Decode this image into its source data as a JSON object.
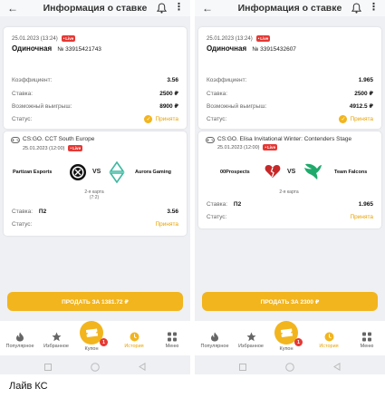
{
  "screens": [
    {
      "header": {
        "title": "Информация о ставке"
      },
      "bet": {
        "datetime": "25.01.2023 (13:24)",
        "live": "Live",
        "type": "Одиночная",
        "number": "№ 33915421743",
        "coef_label": "Коэффициент:",
        "coef_value": "3.56",
        "stake_label": "Ставка:",
        "stake_value": "2500 ₽",
        "win_label": "Возможный выигрыш:",
        "win_value": "8900 ₽",
        "status_label": "Статус:",
        "status_value": "Принята"
      },
      "event": {
        "league": "CS:GO. CCT South Europe",
        "datetime": "25.01.2023 (12:00)",
        "live": "Live",
        "team1": "Partizan Esports",
        "vs": "VS",
        "team2": "Aurora Gaming",
        "map": "2-я карта",
        "score": "(7:2)",
        "stake_label": "Ставка:",
        "stake_value": "П2",
        "coef": "3.56",
        "status_label": "Статус:",
        "status_value": "Принята"
      },
      "sell_button": "ПРОДАТЬ ЗА 1381.72 ₽"
    },
    {
      "header": {
        "title": "Информация о ставке"
      },
      "bet": {
        "datetime": "25.01.2023 (13:24)",
        "live": "Live",
        "type": "Одиночная",
        "number": "№ 33915432607",
        "coef_label": "Коэффициент:",
        "coef_value": "1.965",
        "stake_label": "Ставка:",
        "stake_value": "2500 ₽",
        "win_label": "Возможный выигрыш:",
        "win_value": "4912.5 ₽",
        "status_label": "Статус:",
        "status_value": "Принята"
      },
      "event": {
        "league": "CS:GO. Elisa Invitational Winter: Contenders Stage",
        "datetime": "25.01.2023 (12:00)",
        "live": "Live",
        "team1": "00Prospects",
        "vs": "VS",
        "team2": "Team Falcons",
        "map": "2-я карта",
        "stake_label": "Ставка:",
        "stake_value": "П2",
        "coef": "1.965",
        "status_label": "Статус:",
        "status_value": "Принята"
      },
      "sell_button": "ПРОДАТЬ ЗА 2300 ₽"
    }
  ],
  "nav": {
    "popular": "Популярное",
    "favorites": "Избранное",
    "coupon": "Купон",
    "coupon_count": "1",
    "history": "История",
    "menu": "Меню"
  },
  "caption": "Лайв КС",
  "colors": {
    "accent": "#f2b51e",
    "live": "#e53935",
    "background": "#eef0f3"
  }
}
